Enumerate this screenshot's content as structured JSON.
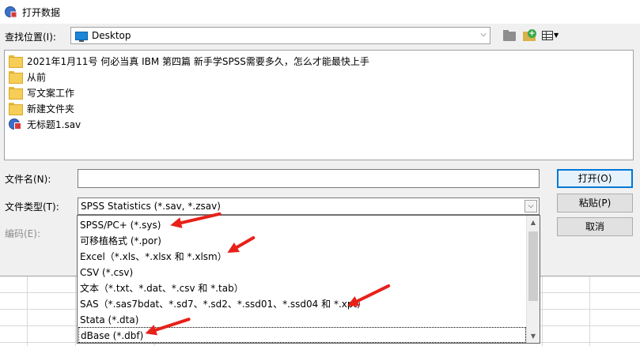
{
  "window": {
    "title": "打开数据"
  },
  "lookin": {
    "label": "查找位置(I):",
    "value": "Desktop"
  },
  "files": [
    {
      "name": "2021年1月11号 何必当真 IBM 第四篇 新手学SPSS需要多久，怎么才能最快上手",
      "type": "folder"
    },
    {
      "name": "从前",
      "type": "folder"
    },
    {
      "name": "写文案工作",
      "type": "folder"
    },
    {
      "name": "新建文件夹",
      "type": "folder"
    },
    {
      "name": "无标题1.sav",
      "type": "sav"
    }
  ],
  "filename": {
    "label": "文件名(N):",
    "value": ""
  },
  "filetype": {
    "label": "文件类型(T):",
    "value": "SPSS Statistics (*.sav, *.zsav)"
  },
  "encoding": {
    "label": "编码(E):"
  },
  "buttons": {
    "open": "打开(O)",
    "paste": "粘贴(P)",
    "cancel": "取消"
  },
  "filetype_options": [
    "SPSS/PC+ (*.sys)",
    "可移植格式 (*.por)",
    "Excel（*.xls、*.xlsx 和 *.xlsm）",
    "CSV (*.csv)",
    "文本（*.txt、*.dat、*.csv 和 *.tab）",
    "SAS（*.sas7bdat、*.sd7、*.sd2、*.ssd01、*.ssd04 和 *.xpt）",
    "Stata (*.dta)",
    "dBase (*.dbf)"
  ],
  "colors": {
    "accent": "#0078d7",
    "annotation": "#e8201a",
    "folder": "#f6cd56"
  },
  "icons": {
    "app": "spss-app-icon",
    "desktop": "desktop-icon",
    "up": "folder-up-icon",
    "new_folder": "new-folder-icon",
    "view": "view-menu-icon",
    "folder": "folder-icon",
    "sav": "sav-file-icon"
  }
}
